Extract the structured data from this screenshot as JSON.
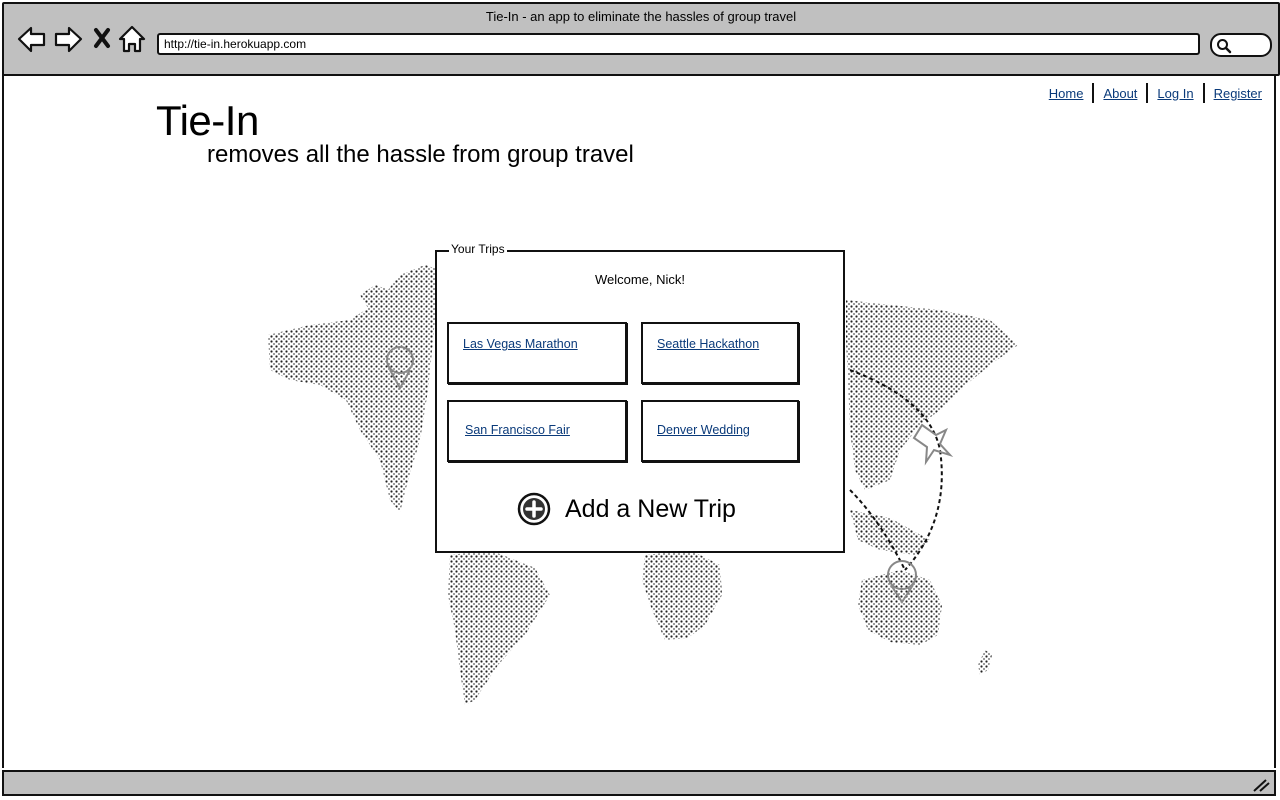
{
  "window": {
    "title": "Tie-In - an app to eliminate the hassles of group travel"
  },
  "browser": {
    "url": "http://tie-in.herokuapp.com",
    "icons": [
      "back-icon",
      "forward-icon",
      "close-icon",
      "home-icon",
      "search-icon"
    ]
  },
  "nav": {
    "home": "Home",
    "about": "About",
    "login": "Log In",
    "register": "Register"
  },
  "hero": {
    "title": "Tie-In",
    "tagline": "removes all the hassle from group travel"
  },
  "trips": {
    "legend": "Your Trips",
    "welcome": "Welcome, Nick!",
    "items": [
      {
        "label": "Las Vegas Marathon"
      },
      {
        "label": "Seattle Hackathon"
      },
      {
        "label": "San Francisco Fair"
      },
      {
        "label": "Denver Wedding"
      }
    ],
    "add_label": "Add a New Trip"
  },
  "colors": {
    "chrome": "#c0c0c0",
    "link": "#0a3a7a",
    "border": "#111111"
  }
}
